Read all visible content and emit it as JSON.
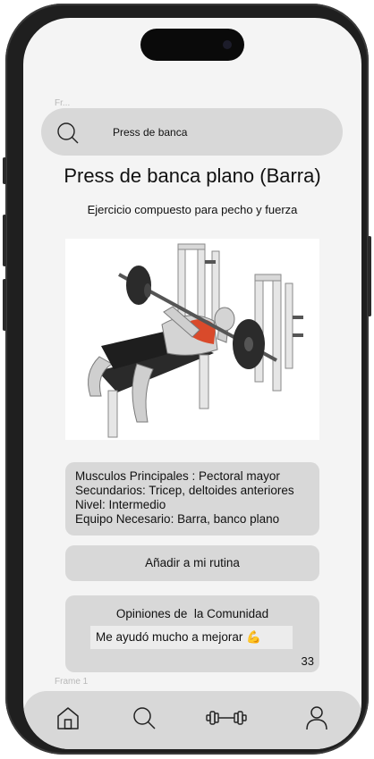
{
  "search": {
    "query": "Press de banca"
  },
  "frame_labels": {
    "top": "Fr...",
    "bottom": "Frame 1"
  },
  "exercise": {
    "title": "Press de banca plano (Barra)",
    "subtitle": "Ejercicio compuesto para pecho y fuerza",
    "image_icon": "bench-press-illustration"
  },
  "info": {
    "primary_muscles": "Musculos Principales : Pectoral mayor",
    "secondary_muscles": "Secundarios: Tricep, deltoides anteriores",
    "level": "Nivel: Intermedio",
    "equipment": "Equipo Necesario: Barra, banco plano"
  },
  "actions": {
    "add_to_routine": "Añadir a mi rutina"
  },
  "community": {
    "title": "Opiniones de  la Comunidad",
    "comment": "Me ayudó mucho a mejorar 💪",
    "count": "33"
  },
  "nav": {
    "items": [
      {
        "icon": "home-icon"
      },
      {
        "icon": "search-icon"
      },
      {
        "icon": "dumbbell-icon"
      },
      {
        "icon": "user-icon"
      }
    ]
  }
}
